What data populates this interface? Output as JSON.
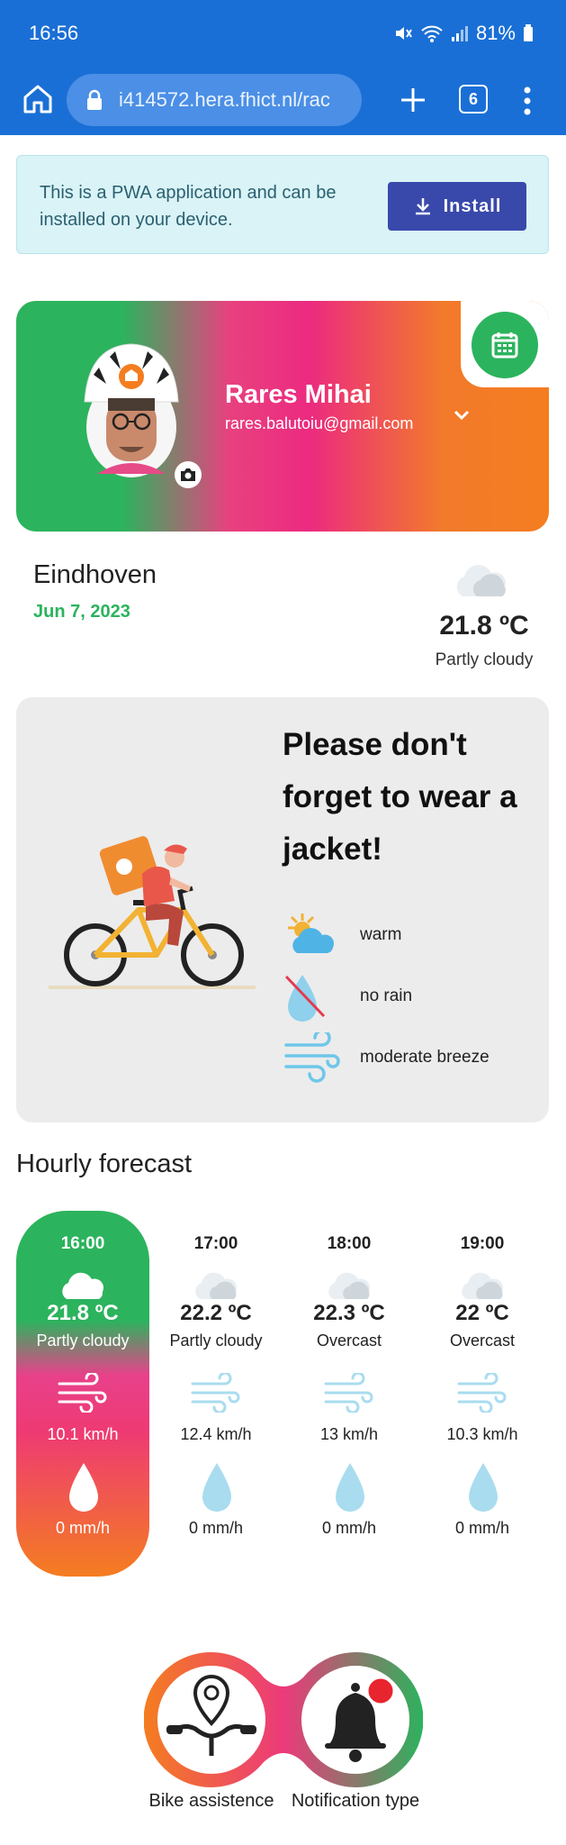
{
  "status_bar": {
    "time": "16:56",
    "battery": "81%"
  },
  "browser": {
    "url": "i414572.hera.fhict.nl/rac",
    "tab_count": "6"
  },
  "banner": {
    "message": "This is a PWA application and can be installed on your device.",
    "install_label": "Install"
  },
  "profile": {
    "name": "Rares Mihai",
    "email": "rares.balutoiu@gmail.com"
  },
  "location": {
    "city": "Eindhoven",
    "date": "Jun 7, 2023"
  },
  "current": {
    "temperature": "21.8 ºC",
    "condition": "Partly cloudy",
    "icon": "partly-cloudy-icon"
  },
  "advice": {
    "headline": "Please don't forget to wear a jacket!",
    "items": [
      {
        "icon": "sun-cloud-icon",
        "label": "warm"
      },
      {
        "icon": "no-rain-icon",
        "label": "no rain"
      },
      {
        "icon": "wind-icon",
        "label": "moderate breeze"
      }
    ]
  },
  "hourly": {
    "title": "Hourly forecast",
    "items": [
      {
        "time": "16:00",
        "temp": "21.8 ºC",
        "condition": "Partly cloudy",
        "wind": "10.1 km/h",
        "rain": "0 mm/h"
      },
      {
        "time": "17:00",
        "temp": "22.2 ºC",
        "condition": "Partly cloudy",
        "wind": "12.4 km/h",
        "rain": "0 mm/h"
      },
      {
        "time": "18:00",
        "temp": "22.3 ºC",
        "condition": "Overcast",
        "wind": "13 km/h",
        "rain": "0 mm/h"
      },
      {
        "time": "19:00",
        "temp": "22 ºC",
        "condition": "Overcast",
        "wind": "10.3 km/h",
        "rain": "0 mm/h"
      }
    ]
  },
  "bottom_nav": {
    "left_label": "Bike assistence",
    "right_label": "Notification type"
  },
  "colors": {
    "green": "#2cb35d",
    "pink": "#ec2a80",
    "orange": "#f47d20",
    "install": "#3949ab",
    "browser": "#1a6fd6"
  }
}
